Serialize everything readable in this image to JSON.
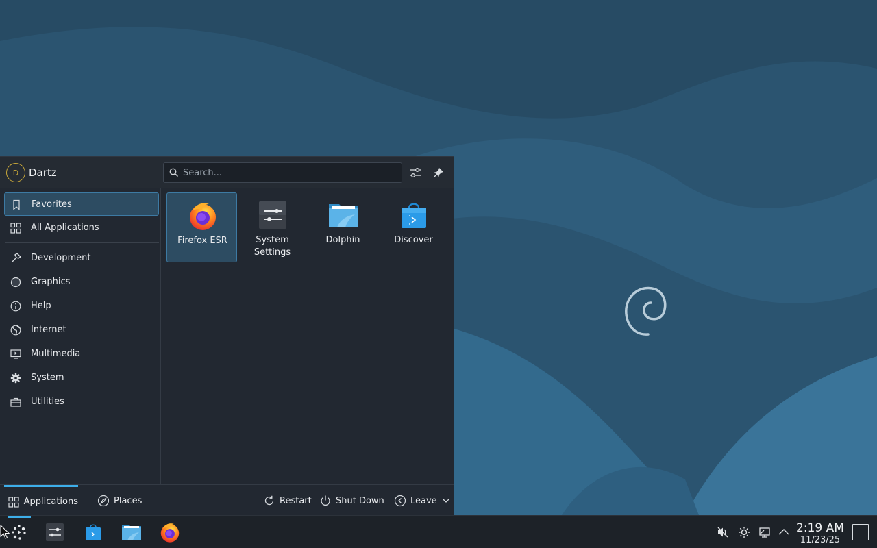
{
  "user": {
    "avatar_initial": "D",
    "name": "Dartz"
  },
  "search": {
    "placeholder": "Search..."
  },
  "sidebar": {
    "items": [
      {
        "label": "Favorites",
        "icon": "bookmark-icon",
        "selected": true
      },
      {
        "label": "All Applications",
        "icon": "grid-icon"
      },
      {
        "label": "Development",
        "icon": "hammer-icon"
      },
      {
        "label": "Graphics",
        "icon": "palette-icon"
      },
      {
        "label": "Help",
        "icon": "info-icon"
      },
      {
        "label": "Internet",
        "icon": "globe-icon"
      },
      {
        "label": "Multimedia",
        "icon": "monitor-play-icon"
      },
      {
        "label": "System",
        "icon": "gear-icon"
      },
      {
        "label": "Utilities",
        "icon": "toolbox-icon"
      }
    ]
  },
  "favorites": [
    {
      "label": "Firefox ESR",
      "icon": "firefox-icon",
      "selected": true
    },
    {
      "label": "System Settings",
      "icon": "system-settings-icon"
    },
    {
      "label": "Dolphin",
      "icon": "dolphin-folder-icon"
    },
    {
      "label": "Discover",
      "icon": "discover-bag-icon"
    }
  ],
  "footer": {
    "applications_label": "Applications",
    "places_label": "Places",
    "restart_label": "Restart",
    "shutdown_label": "Shut Down",
    "leave_label": "Leave"
  },
  "taskbar": {
    "clock_time": "2:19 AM",
    "clock_date": "11/23/25"
  },
  "colors": {
    "accent": "#3daee9",
    "panel_bg": "#222831",
    "selection_bg": "#2d4c62"
  }
}
